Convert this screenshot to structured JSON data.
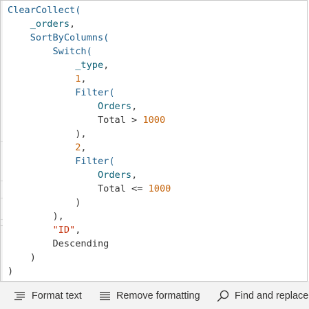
{
  "editor": {
    "lines": [
      [
        {
          "t": "ClearCollect(",
          "c": "func"
        }
      ],
      [
        {
          "t": "    ",
          "c": "plain"
        },
        {
          "t": "_orders",
          "c": "ident"
        },
        {
          "t": ",",
          "c": "plain"
        }
      ],
      [
        {
          "t": "    ",
          "c": "plain"
        },
        {
          "t": "SortByColumns(",
          "c": "func"
        }
      ],
      [
        {
          "t": "        ",
          "c": "plain"
        },
        {
          "t": "Switch(",
          "c": "func"
        }
      ],
      [
        {
          "t": "            ",
          "c": "plain"
        },
        {
          "t": "_type",
          "c": "ident"
        },
        {
          "t": ",",
          "c": "plain"
        }
      ],
      [
        {
          "t": "            ",
          "c": "plain"
        },
        {
          "t": "1",
          "c": "num"
        },
        {
          "t": ",",
          "c": "plain"
        }
      ],
      [
        {
          "t": "            ",
          "c": "plain"
        },
        {
          "t": "Filter(",
          "c": "func"
        }
      ],
      [
        {
          "t": "                ",
          "c": "plain"
        },
        {
          "t": "Orders",
          "c": "ident"
        },
        {
          "t": ",",
          "c": "plain"
        }
      ],
      [
        {
          "t": "                ",
          "c": "plain"
        },
        {
          "t": "Total > ",
          "c": "plain"
        },
        {
          "t": "1000",
          "c": "num"
        }
      ],
      [
        {
          "t": "            ",
          "c": "plain"
        },
        {
          "t": "),",
          "c": "plain"
        }
      ],
      [
        {
          "t": "            ",
          "c": "plain"
        },
        {
          "t": "2",
          "c": "num"
        },
        {
          "t": ",",
          "c": "plain"
        }
      ],
      [
        {
          "t": "            ",
          "c": "plain"
        },
        {
          "t": "Filter(",
          "c": "func"
        }
      ],
      [
        {
          "t": "                ",
          "c": "plain"
        },
        {
          "t": "Orders",
          "c": "ident"
        },
        {
          "t": ",",
          "c": "plain"
        }
      ],
      [
        {
          "t": "                ",
          "c": "plain"
        },
        {
          "t": "Total <= ",
          "c": "plain"
        },
        {
          "t": "1000",
          "c": "num"
        }
      ],
      [
        {
          "t": "            ",
          "c": "plain"
        },
        {
          "t": ")",
          "c": "plain"
        }
      ],
      [
        {
          "t": "        ",
          "c": "plain"
        },
        {
          "t": "),",
          "c": "plain"
        }
      ],
      [
        {
          "t": "        ",
          "c": "plain"
        },
        {
          "t": "\"ID\"",
          "c": "str"
        },
        {
          "t": ",",
          "c": "plain"
        }
      ],
      [
        {
          "t": "        ",
          "c": "plain"
        },
        {
          "t": "Descending",
          "c": "plain"
        }
      ],
      [
        {
          "t": "    ",
          "c": "plain"
        },
        {
          "t": ")",
          "c": "plain"
        }
      ],
      [
        {
          "t": ")",
          "c": "plain"
        }
      ]
    ]
  },
  "toolbar": {
    "format_text_label": "Format text",
    "format_text_icon": "format-text-icon",
    "remove_formatting_label": "Remove formatting",
    "remove_formatting_icon": "remove-formatting-icon",
    "find_replace_label": "Find and replace",
    "find_replace_icon": "search-icon"
  },
  "colors": {
    "function": "#1c5d8a",
    "identifier": "#0b5f75",
    "number": "#c5640c",
    "string": "#c5320c",
    "plain": "#333333",
    "toolbar_bg": "#f3f3f3"
  }
}
